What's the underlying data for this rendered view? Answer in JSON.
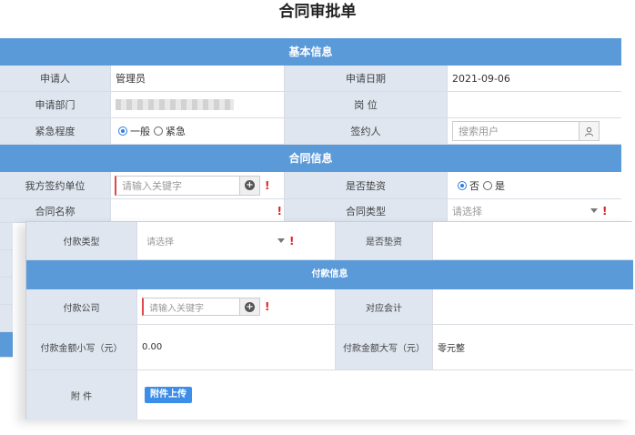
{
  "title": "合同审批单",
  "basic": {
    "section": "基本信息",
    "applicant_label": "申请人",
    "applicant_value": "管理员",
    "apply_date_label": "申请日期",
    "apply_date_value": "2021-09-06",
    "dept_label": "申请部门",
    "position_label": "岗  位",
    "urgency_label": "紧急程度",
    "urgency_normal": "一般",
    "urgency_urgent": "紧急",
    "signer_label": "签约人",
    "signer_placeholder": "搜索用户"
  },
  "contract": {
    "section": "合同信息",
    "our_unit_label": "我方签约单位",
    "our_unit_placeholder": "请输入关键字",
    "advance_label": "是否垫资",
    "advance_no": "否",
    "advance_yes": "是",
    "name_label": "合同名称",
    "type_label": "合同类型",
    "type_placeholder": "请选择",
    "required_mark": "!"
  },
  "overlay": {
    "pay_type_label": "付款类型",
    "pay_type_placeholder": "请选择",
    "advance_label": "是否垫资",
    "section": "付款信息",
    "pay_company_label": "付款公司",
    "pay_company_placeholder": "请输入关键字",
    "account_label": "对应会计",
    "amount_small_label": "付款金额小写（元）",
    "amount_small_value": "0.00",
    "amount_big_label": "付款金额大写（元）",
    "amount_big_value": "零元整",
    "attachment_label": "附  件",
    "upload_button": "附件上传"
  }
}
